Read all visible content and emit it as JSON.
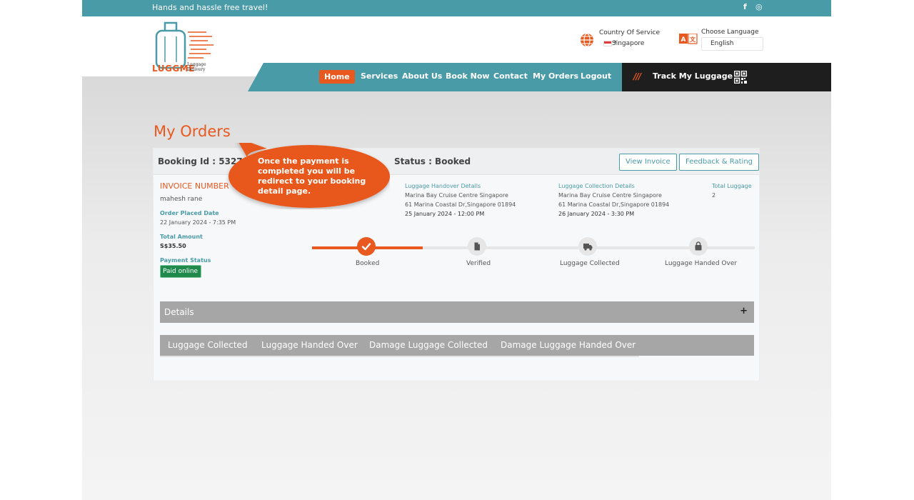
{
  "topbar": {
    "tagline": "Hands and hassle free travel!",
    "social": [
      {
        "icon": "facebook-icon",
        "glyph": "f"
      },
      {
        "icon": "instagram-icon",
        "glyph": "◎"
      }
    ]
  },
  "logo": {
    "text": "LUGGME",
    "sub_line1": "Luggage",
    "sub_line2": "Delivery"
  },
  "header": {
    "country_label": "Country Of Service",
    "country_value": "Singapore",
    "language_label": "Choose Language",
    "language_value": "English"
  },
  "nav": {
    "items": [
      "Home",
      "Services",
      "About Us",
      "Book Now",
      "Contact",
      "My Orders",
      "Logout"
    ],
    "active": "Home",
    "track_label": "Track My Luggage",
    "track_slashes": "///"
  },
  "page": {
    "title": "My Orders"
  },
  "order": {
    "booking_id": "Booking Id : 53272",
    "status": "Status : Booked",
    "view_invoice": "View Invoice",
    "feedback": "Feedback & Rating",
    "invoice_label": "INVOICE NUMBER",
    "customer": "mahesh rane",
    "order_placed_label": "Order Placed Date",
    "order_placed_value": "22 January 2024 - 7:35 PM",
    "total_amount_label": "Total Amount",
    "total_amount_value": "S$35.50",
    "payment_status_label": "Payment Status",
    "payment_status_value": "Paid online",
    "handover": {
      "label": "Luggage Handover Details",
      "place": "Marina Bay Cruise Centre Singapore",
      "address": "61 Marina Coastal Dr,Singapore 01894",
      "datetime": "25 January 2024 - 12:00 PM"
    },
    "collection": {
      "label": "Luggage Collection Details",
      "place": "Marina Bay Cruise Centre Singapore",
      "address": "61 Marina Coastal Dr,Singapore 01894",
      "datetime": "26 January 2024 - 3:30 PM"
    },
    "total_luggage_label": "Total Luggage",
    "total_luggage_value": "2",
    "steps": [
      {
        "label": "Booked",
        "icon": "check-icon",
        "done": true
      },
      {
        "label": "Verified",
        "icon": "document-icon",
        "done": false
      },
      {
        "label": "Luggage Collected",
        "icon": "truck-icon",
        "done": false
      },
      {
        "label": "Luggage Handed Over",
        "icon": "bag-icon",
        "done": false
      }
    ],
    "details_label": "Details",
    "details_toggle": "+",
    "tabs": [
      "Luggage Collected",
      "Luggage Handed Over",
      "Damage Luggage Collected",
      "Damage Luggage Handed Over"
    ]
  },
  "tooltip": {
    "text": "Once the payment is completed you will be redirect to your booking detail page."
  },
  "colors": {
    "accent": "#e8581f",
    "teal": "#4a9ba8",
    "dark": "#1e1e1e",
    "paid": "#1f8a4c"
  }
}
